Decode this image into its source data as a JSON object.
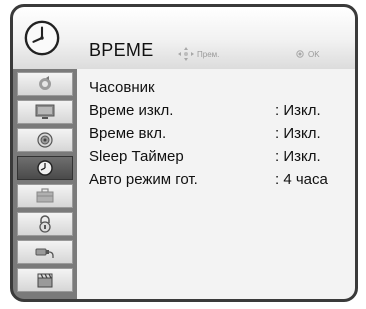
{
  "header": {
    "title": "ВРЕМЕ",
    "hint_move_label": "Прем.",
    "hint_ok_label": "OK",
    "icon": "clock-icon"
  },
  "sidebar": {
    "items": [
      {
        "icon": "picture-icon"
      },
      {
        "icon": "monitor-icon"
      },
      {
        "icon": "speaker-icon"
      },
      {
        "icon": "clock-icon",
        "selected": true
      },
      {
        "icon": "toolbox-icon"
      },
      {
        "icon": "lock-icon"
      },
      {
        "icon": "plug-icon"
      },
      {
        "icon": "clapperboard-icon"
      }
    ]
  },
  "menu": {
    "items": [
      {
        "label": "Часовник",
        "value": ""
      },
      {
        "label": "Време изкл.",
        "value": ": Изкл."
      },
      {
        "label": "Време вкл.",
        "value": ": Изкл."
      },
      {
        "label": "Sleep Таймер",
        "value": ": Изкл."
      },
      {
        "label": "Авто режим гот.",
        "value": ": 4 часа"
      }
    ]
  },
  "colors": {
    "sidebar_bg": "#7a7a7a",
    "selected_item": "#555555",
    "content_bg": "#f3f3f3"
  }
}
